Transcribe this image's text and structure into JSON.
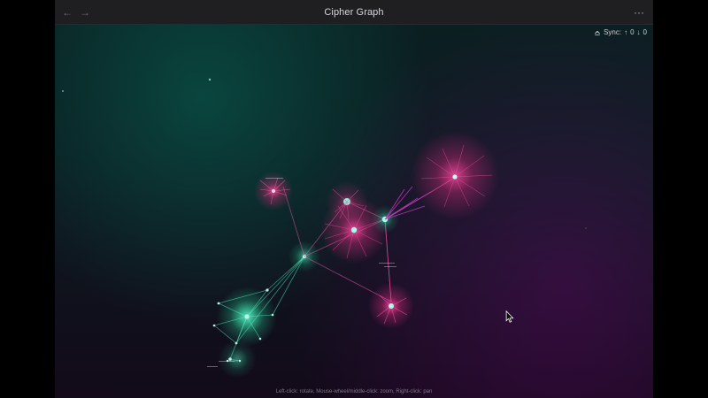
{
  "window": {
    "title": "Cipher Graph",
    "nav": {
      "back_icon": "arrow-left-icon",
      "forward_icon": "arrow-right-icon"
    },
    "more_icon": "more-icon",
    "more_label": "···"
  },
  "sync": {
    "label": "Sync:",
    "up_label": "↑",
    "up_count": "0",
    "down_label": "↓",
    "down_count": "0",
    "icon": "sync-icon"
  },
  "canvas": {
    "hint": "Left-click: rotate, Mouse-wheel/middle-click: zoom, Right-click: pan"
  }
}
